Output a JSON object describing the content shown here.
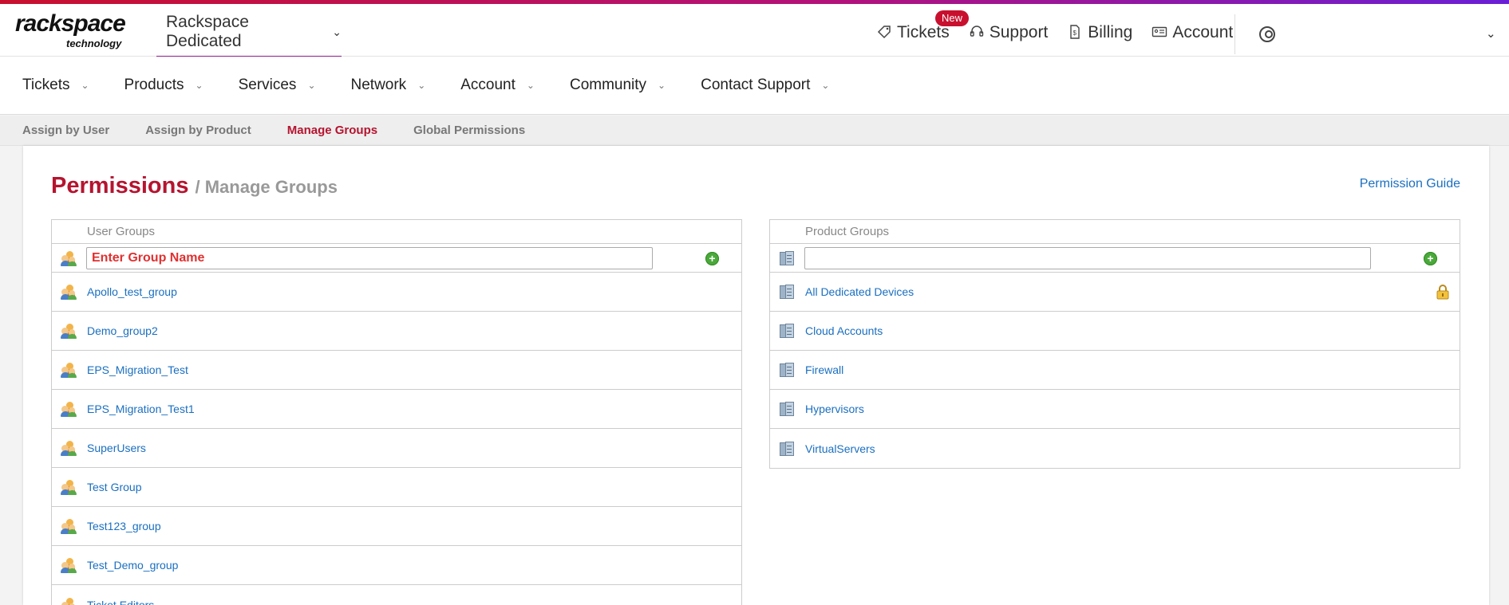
{
  "header": {
    "logo_line1": "rackspace",
    "logo_line2": "technology",
    "account_switcher": "Rackspace Dedicated",
    "links": [
      {
        "label": "Tickets",
        "icon": "ticket-icon",
        "badge": "New"
      },
      {
        "label": "Support",
        "icon": "headset-icon"
      },
      {
        "label": "Billing",
        "icon": "invoice-icon"
      },
      {
        "label": "Account",
        "icon": "id-card-icon"
      }
    ]
  },
  "main_nav": [
    "Tickets",
    "Products",
    "Services",
    "Network",
    "Account",
    "Community",
    "Contact Support"
  ],
  "sub_nav": {
    "items": [
      "Assign by User",
      "Assign by Product",
      "Manage Groups",
      "Global Permissions"
    ],
    "active": "Manage Groups"
  },
  "page": {
    "title": "Permissions",
    "subtitle": "/ Manage Groups",
    "guide_link": "Permission Guide"
  },
  "user_groups": {
    "header": "User Groups",
    "input_placeholder": "Enter Group Name",
    "items": [
      "Apollo_test_group",
      "Demo_group2",
      "EPS_Migration_Test",
      "EPS_Migration_Test1",
      "SuperUsers",
      "Test Group",
      "Test123_group",
      "Test_Demo_group",
      "Ticket Editors"
    ]
  },
  "product_groups": {
    "header": "Product Groups",
    "input_placeholder": "",
    "items": [
      "All Dedicated Devices",
      "Cloud Accounts",
      "Firewall",
      "Hypervisors",
      "VirtualServers"
    ]
  },
  "colors": {
    "brand_red": "#c8102e",
    "active_red": "#b5142f",
    "link_blue": "#1a6fc0",
    "add_green": "#4aa93a"
  }
}
